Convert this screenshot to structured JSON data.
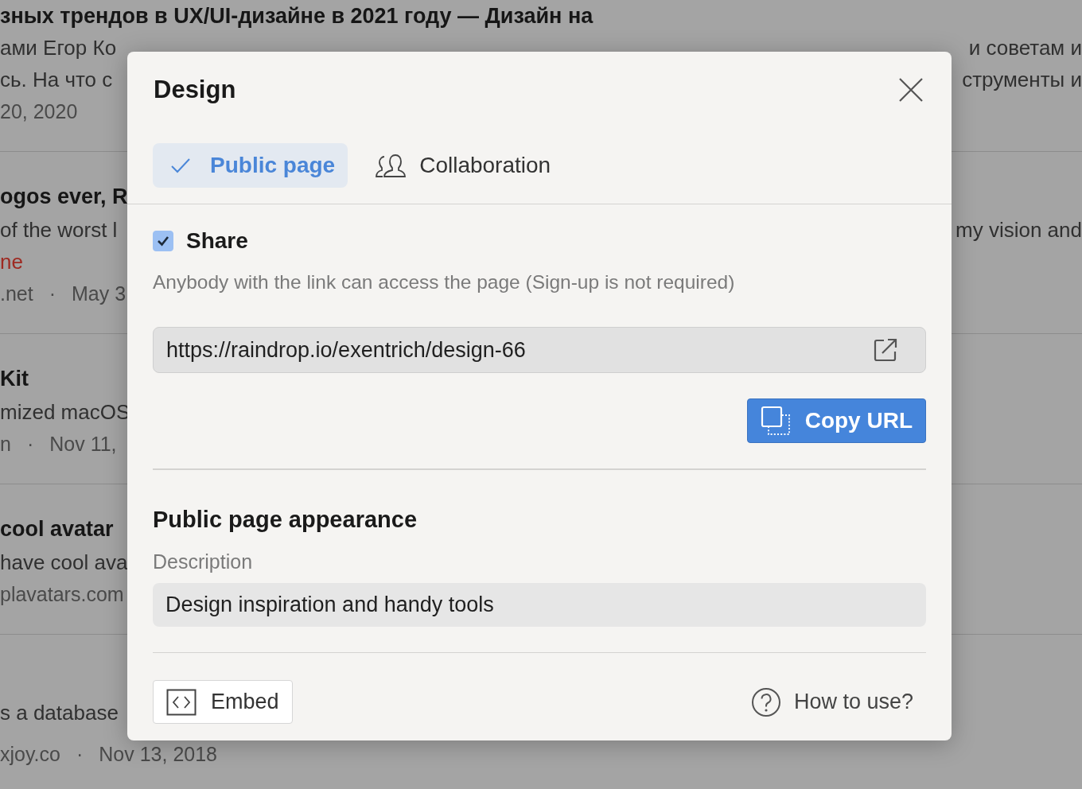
{
  "background": {
    "items": [
      {
        "title": {
          "left": "зных трендов в UX/UI-дизайне в 2021 году — Дизайн на"
        },
        "lines": [
          {
            "kind": "text",
            "left": "ами Егор Ко",
            "right": "и советам и"
          },
          {
            "kind": "text",
            "left": "сь. На что с",
            "right": "струменты и"
          }
        ],
        "meta": [
          "20, 2020"
        ]
      },
      {
        "title": {
          "left": "ogos ever, R"
        },
        "lines": [
          {
            "kind": "text",
            "left": "of the worst l",
            "right": "my vision and"
          },
          {
            "kind": "highlight",
            "left": "ne"
          }
        ],
        "meta": [
          ".net",
          "·",
          "May 3"
        ]
      },
      {
        "title": {
          "left": "Kit"
        },
        "lines": [
          {
            "kind": "text",
            "left": "mized macOS"
          }
        ],
        "meta": [
          "n",
          "·",
          "Nov 11,"
        ]
      },
      {
        "title": {
          "left": "cool avatar"
        },
        "lines": [
          {
            "kind": "text",
            "left": "have cool ava"
          }
        ],
        "meta": [
          "plavatars.com"
        ]
      },
      {
        "lines": [
          {
            "kind": "text",
            "left": "s a database"
          }
        ],
        "meta": [
          "xjoy.co",
          "·",
          "Nov 13, 2018"
        ]
      }
    ]
  },
  "dialog": {
    "title": "Design",
    "tabs": [
      {
        "label": "Public page",
        "selected": true
      },
      {
        "label": "Collaboration",
        "selected": false
      }
    ],
    "share": {
      "label": "Share",
      "checked": true,
      "hint": "Anybody with the link can access the page (Sign-up is not required)"
    },
    "url": {
      "value": "https://raindrop.io/exentrich/design-66"
    },
    "copy_button": "Copy URL",
    "appearance": {
      "heading": "Public page appearance",
      "description_label": "Description",
      "description_value": "Design inspiration and handy tools"
    },
    "embed_button": "Embed",
    "help_link": "How to use?"
  }
}
